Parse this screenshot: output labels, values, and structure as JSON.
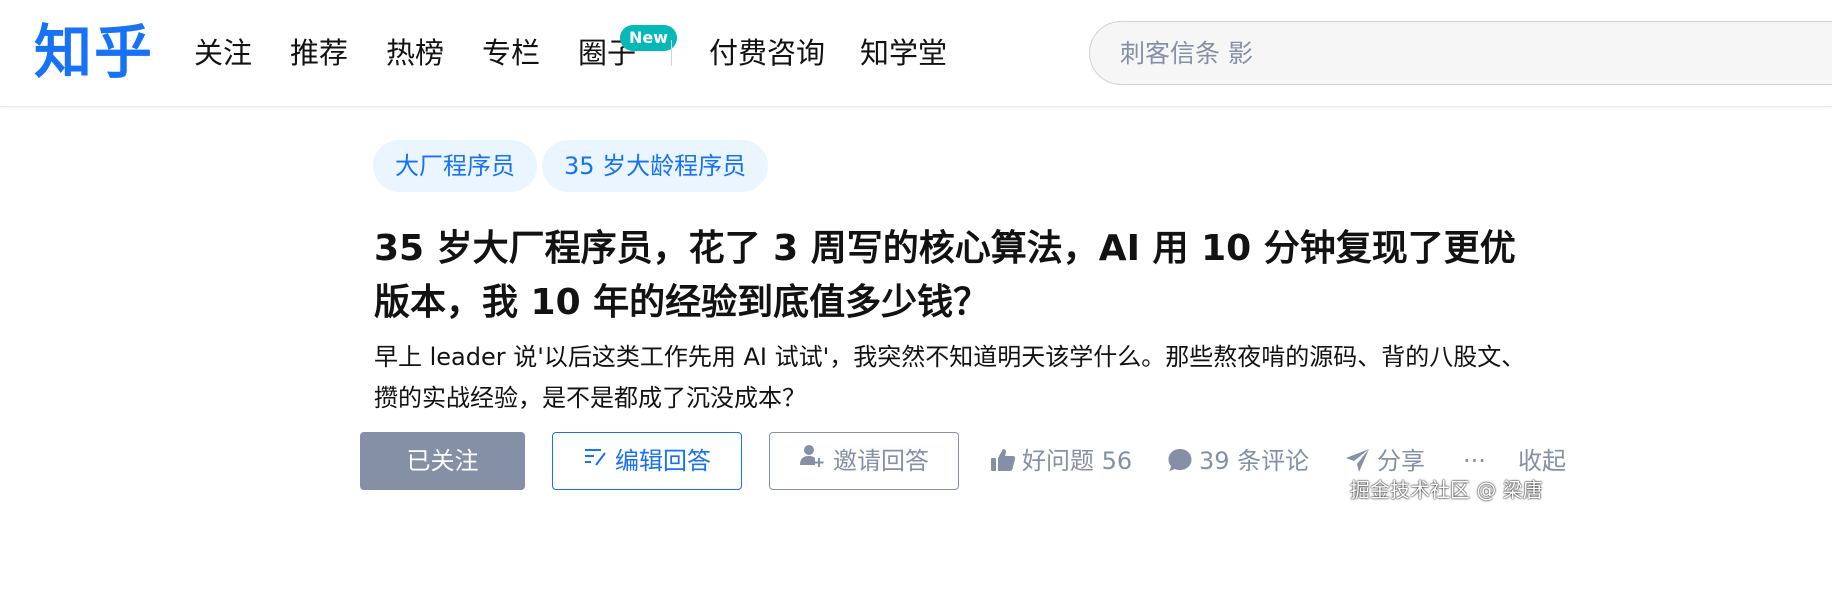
{
  "header": {
    "logo": "知乎",
    "nav": [
      "关注",
      "推荐",
      "热榜",
      "专栏",
      "圈子",
      "付费咨询",
      "知学堂"
    ],
    "nav_badge": "New",
    "search": {
      "placeholder": "刺客信条 影"
    }
  },
  "question": {
    "topics": [
      "大厂程序员",
      "35 岁大龄程序员"
    ],
    "title": "35 岁大厂程序员，花了 3 周写的核心算法，AI 用 10 分钟复现了更优版本，我 10 年的经验到底值多少钱？",
    "detail": "早上 leader 说'以后这类工作先用 AI 试试'，我突然不知道明天该学什么。那些熬夜啃的源码、背的八股文、攒的实战经验，是不是都成了沉没成本？"
  },
  "actions": {
    "follow": "已关注",
    "edit_answer": "编辑回答",
    "invite_answer": "邀请回答",
    "good_question": "好问题 56",
    "comments": "39 条评论",
    "share": "分享",
    "more": "···",
    "collapse": "收起"
  },
  "watermark": "掘金技术社区 @ 梁唐",
  "colors": {
    "brand": "#1772f6",
    "badge": "#06b8b8",
    "muted": "#8590a6",
    "topic_bg": "#ebf5ff",
    "text": "#121212"
  },
  "icons": [
    "edit-icon",
    "add-user-icon",
    "thumb-up-icon",
    "comment-bubble-icon",
    "paper-plane-icon"
  ]
}
